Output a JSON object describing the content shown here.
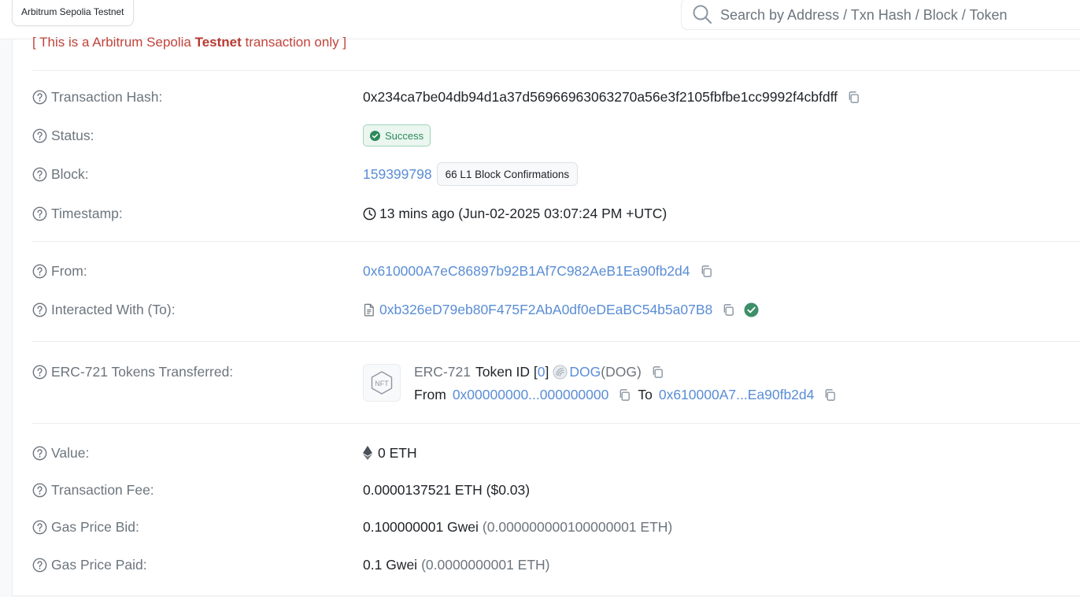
{
  "header": {
    "network_label": "Arbitrum Sepolia Testnet",
    "search_placeholder": "Search by Address / Txn Hash / Block / Token"
  },
  "notice": {
    "prefix": "[ This is a Arbitrum Sepolia ",
    "bold": "Testnet",
    "suffix": " transaction only ]"
  },
  "fields": {
    "tx_hash": {
      "label": "Transaction Hash:",
      "value": "0x234ca7be04db94d1a37d56966963063270a56e3f2105fbfbe1cc9992f4cbfdff"
    },
    "status": {
      "label": "Status:",
      "value": "Success"
    },
    "block": {
      "label": "Block:",
      "value": "159399798",
      "confirmations": "66 L1 Block Confirmations"
    },
    "timestamp": {
      "label": "Timestamp:",
      "value": "13 mins ago (Jun-02-2025 03:07:24 PM +UTC)"
    },
    "from": {
      "label": "From:",
      "value": "0x610000A7eC86897b92B1Af7C982AeB1Ea90fb2d4"
    },
    "to": {
      "label": "Interacted With (To):",
      "value": "0xb326eD79eb80F475F2AbA0df0eDEaBC54b5a07B8"
    },
    "erc721": {
      "label": "ERC-721 Tokens Transferred:",
      "standard": "ERC-721",
      "token_id_label": "Token ID [",
      "token_id": "0",
      "token_id_close": "]",
      "token_name": "DOG",
      "token_symbol": "(DOG)",
      "from_label": "From",
      "from_addr": "0x00000000...000000000",
      "to_label": "To",
      "to_addr": "0x610000A7...Ea90fb2d4",
      "nft_badge": "NFT"
    },
    "value": {
      "label": "Value:",
      "value": "0 ETH"
    },
    "fee": {
      "label": "Transaction Fee:",
      "value": "0.0000137521 ETH ($0.03)"
    },
    "gas_bid": {
      "label": "Gas Price Bid:",
      "value": "0.100000001 Gwei",
      "detail": "(0.000000000100000001 ETH)"
    },
    "gas_paid": {
      "label": "Gas Price Paid:",
      "value": "0.1 Gwei",
      "detail": "(0.0000000001 ETH)"
    }
  },
  "icons": {
    "help": "question-circle-icon",
    "copy": "copy-icon",
    "clock": "clock-icon",
    "contract": "file-icon",
    "verified": "check-circle-icon",
    "eth": "ethereum-icon",
    "search": "search-icon"
  },
  "colors": {
    "link": "#5a8dd6",
    "success": "#2c8a5b",
    "notice": "#c2433b",
    "label": "#6c757d"
  }
}
